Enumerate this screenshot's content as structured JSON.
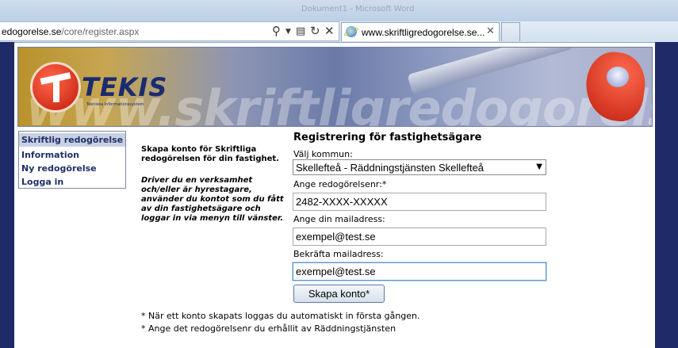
{
  "browser": {
    "background_tab": "Dokument1 - Microsoft Word",
    "address_domain": "edogorelse.se",
    "address_path": "/core/register.aspx",
    "tab_title": "www.skriftligredogorelse.se...",
    "icons": [
      "search-icon",
      "dropdown-icon",
      "compat-view-icon",
      "refresh-icon",
      "stop-icon",
      "ie-icon",
      "close-icon"
    ]
  },
  "banner": {
    "logo_text": "TEKIS",
    "logo_subtext": "Tekniska Informationssystem",
    "watermark": "www.skriftligredogorelse.se"
  },
  "menu": {
    "items": [
      {
        "label": "Skriftlig redogörelse",
        "active": true
      },
      {
        "label": "Information"
      },
      {
        "label": "Ny redogörelse"
      },
      {
        "label": "Logga in"
      }
    ]
  },
  "intro": {
    "bold": "Skapa konto för Skriftliga redogörelsen för din fastighet.",
    "italic": "Driver du en verksamhet och/eller är hyrestagare, använder du kontot som du fått av din fastighetsägare och loggar in via menyn till vänster."
  },
  "form": {
    "title": "Registrering för fastighetsägare",
    "kommun_label": "Välj kommun:",
    "kommun_value": "Skellefteå - Räddningstjänsten Skellefteå",
    "redog_label": "Ange redogörelsenr:*",
    "redog_value": "2482-XXXX-XXXXX",
    "mail_label": "Ange din mailadress:",
    "mail_value": "exempel@test.se",
    "confirm_label": "Bekräfta mailadress:",
    "confirm_value": "exempel@test.se",
    "submit_label": "Skapa konto*"
  },
  "notes": [
    "* När ett konto skapats loggas du automatiskt in första gången.",
    "* Ange det redogörelsenr du erhållit av Räddningstjänsten"
  ],
  "colors": {
    "frame_navy": "#1e2b68",
    "menu_text": "#1f3069",
    "brand_red": "#c3190b"
  }
}
